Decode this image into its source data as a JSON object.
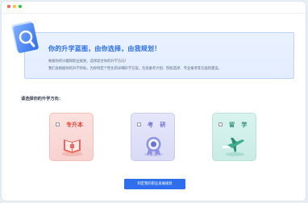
{
  "banner": {
    "title": "你的升学蓝图，由你选择，由我规划！",
    "line1": "根据你的兴趣和职业规划，选择适合你的升学方向！",
    "line2": "我们会根据你的升学目标，为你制定个性化的详细升学方案，包括备考计划、院校选择、专业报考等方面的建议。"
  },
  "section": {
    "label": "请选择你的升学方向："
  },
  "options": [
    {
      "label": "专升本",
      "color": "#e8453c"
    },
    {
      "label": "考 研",
      "color": "#6a6fd6"
    },
    {
      "label": "留 学",
      "color": "#2f8f76"
    }
  ],
  "button": {
    "label": "制定我的职业发展规划"
  },
  "colors": {
    "accent": "#2f6fed",
    "banner_bg": "#e3edff"
  },
  "icons": [
    "document-search-icon",
    "book-icon",
    "medal-icon",
    "airplane-icon"
  ]
}
